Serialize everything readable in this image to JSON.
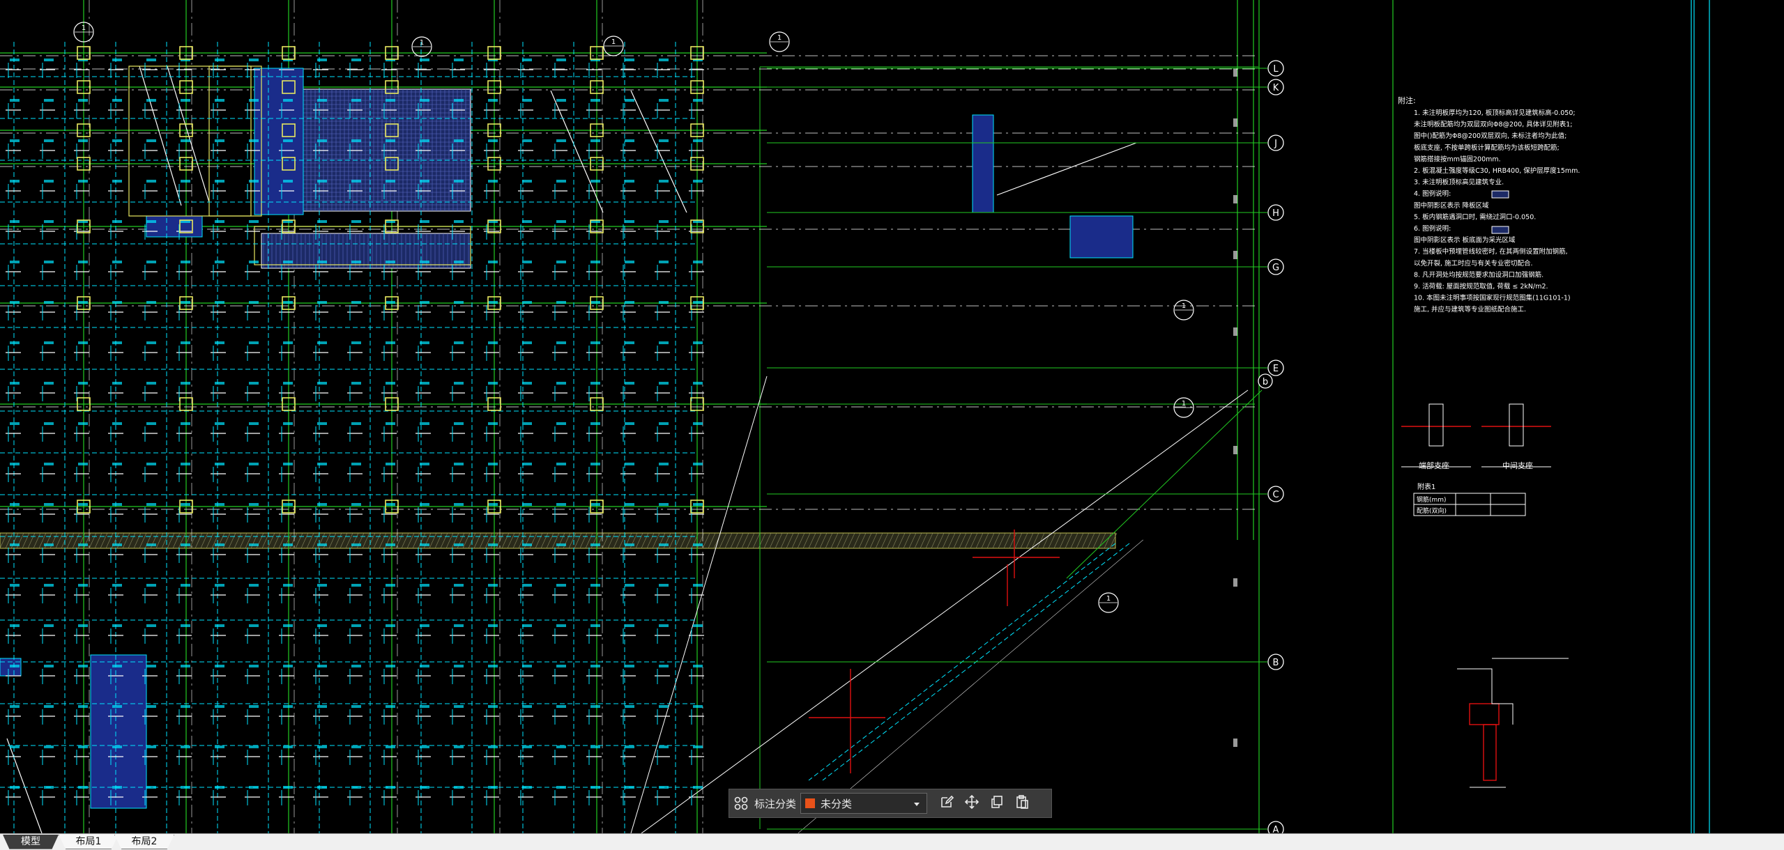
{
  "drawing": {
    "grid_axes_right": [
      "L",
      "K",
      "J",
      "H",
      "G",
      "E",
      "C",
      "B",
      "A"
    ],
    "grid_axis_diag": "b",
    "circle_marker": "1",
    "detail_labels": {
      "left": "端部支座",
      "right": "中间支座",
      "table_title": "附表1",
      "table_row1": "钢筋(mm)",
      "table_row2": "配筋(双向)"
    },
    "notes_title": "附注:",
    "notes": [
      "1. 未注明板厚均为120, 板顶标高详见建筑标高-0.050;",
      "未注明板配筋均为双层双向Φ8@200, 具体详见附表1;",
      "图中()配筋为Φ8@200双层双向, 未标注者均为此值;",
      "板底支座, 不按单跨板计算配筋均为该板短跨配筋;",
      "钢筋搭接按mm锚固200mm.",
      "2. 板混凝土强度等级C30, HRB400, 保护层厚度15mm.",
      "3. 未注明板顶标高见建筑专业.",
      "4. 图例说明:",
      "图中阴影区表示 降板区域",
      "5. 板内钢筋遇洞口时, 需绕过洞口-0.050.",
      "6. 图例说明:",
      "图中阴影区表示 板底面为采光区域",
      "7. 当楼板中预埋管线较密时, 在其两侧设置附加钢筋,",
      "以免开裂, 施工时应与有关专业密切配合.",
      "8. 凡开洞处均按规范要求加设洞口加强钢筋.",
      "9. 活荷载: 屋面按规范取值, 荷载 ≤ 2kN/m2.",
      "10. 本图未注明事项按国家现行规范图集(11G101-1)",
      "施工, 并应与建筑等专业图纸配合施工."
    ]
  },
  "toolbar": {
    "category_label": "标注分类",
    "category_value": "未分类",
    "category_color": "#e8521a",
    "icons": [
      "grid-apps-icon",
      "edit-icon",
      "move-icon",
      "copy-icon",
      "paste-icon"
    ]
  },
  "tabs": [
    {
      "label": "模型",
      "active": true
    },
    {
      "label": "布局1",
      "active": false
    },
    {
      "label": "布局2",
      "active": false
    }
  ],
  "colors": {
    "background": "#000000",
    "grid_green": "#22cc22",
    "rebar_cyan": "#00e5ff",
    "column_yellow": "#e8e860",
    "white_line": "#ffffff",
    "red_line": "#e01010",
    "blue_fill": "#1a2c8a"
  }
}
